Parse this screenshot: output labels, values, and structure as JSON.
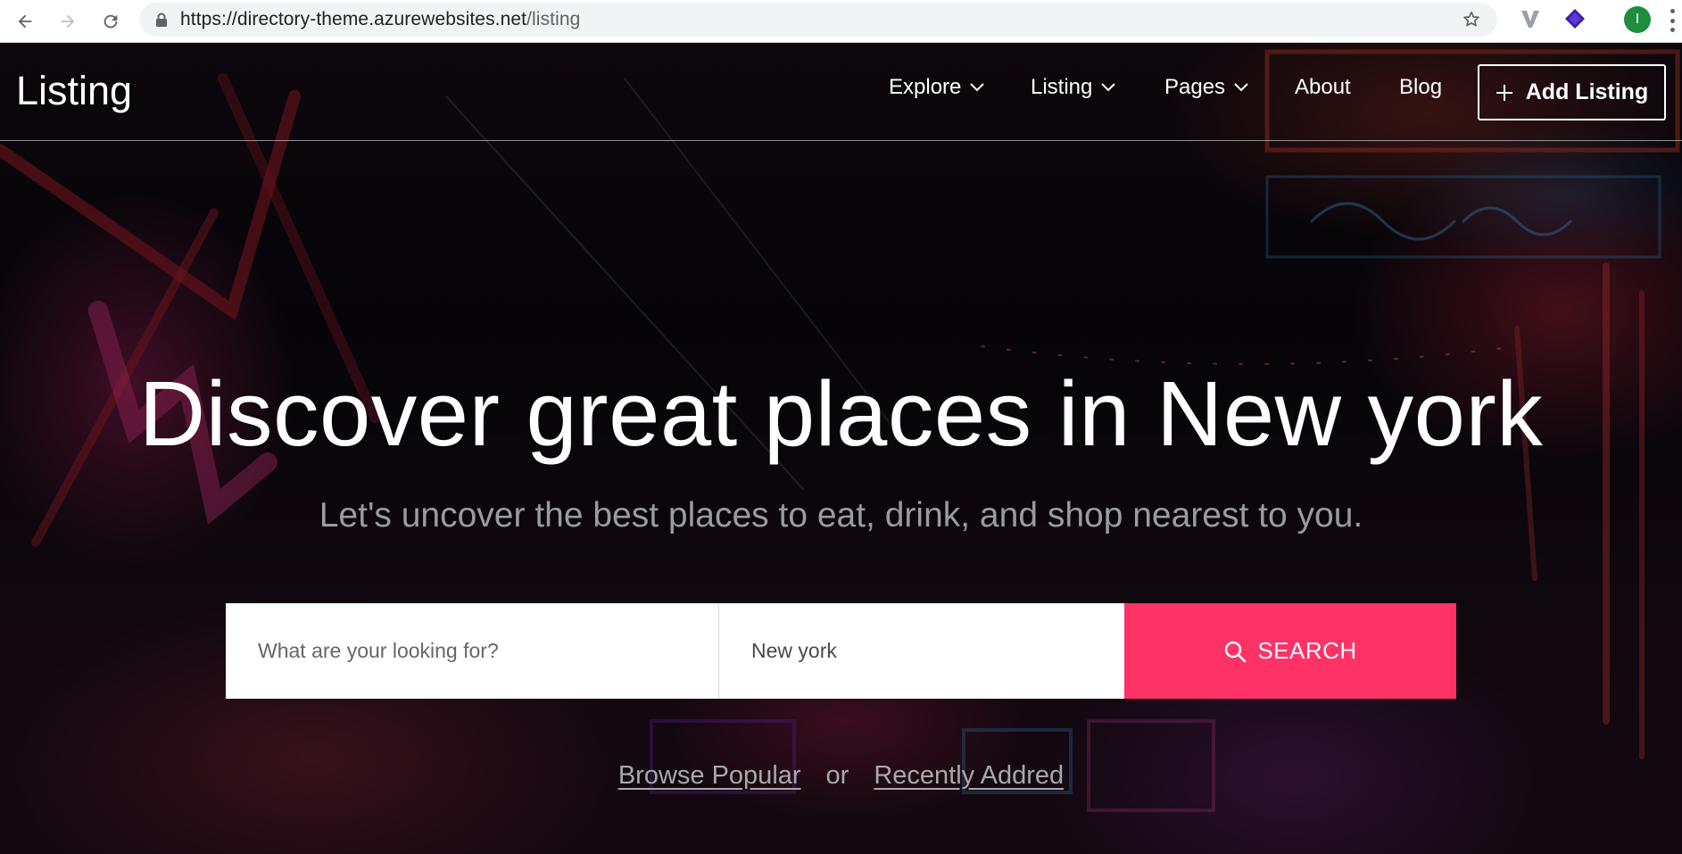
{
  "browser": {
    "url_host": "https://directory-theme.azurewebsites.net",
    "url_path": "/listing",
    "profile_initial": "I"
  },
  "site": {
    "brand": "Listing",
    "nav": {
      "explore": "Explore",
      "listing": "Listing",
      "pages": "Pages",
      "about": "About",
      "blog": "Blog"
    },
    "add_listing": "Add Listing"
  },
  "hero": {
    "title": "Discover great places in New york",
    "subtitle": "Let's uncover the best places to eat, drink, and shop nearest to you."
  },
  "search": {
    "what_placeholder": "What are your looking for?",
    "where_value": "New york",
    "button_label": "SEARCH",
    "accent_color": "#ff3268"
  },
  "browse": {
    "popular": "Browse Popular",
    "or": "or",
    "recent": "Recently Addred"
  }
}
